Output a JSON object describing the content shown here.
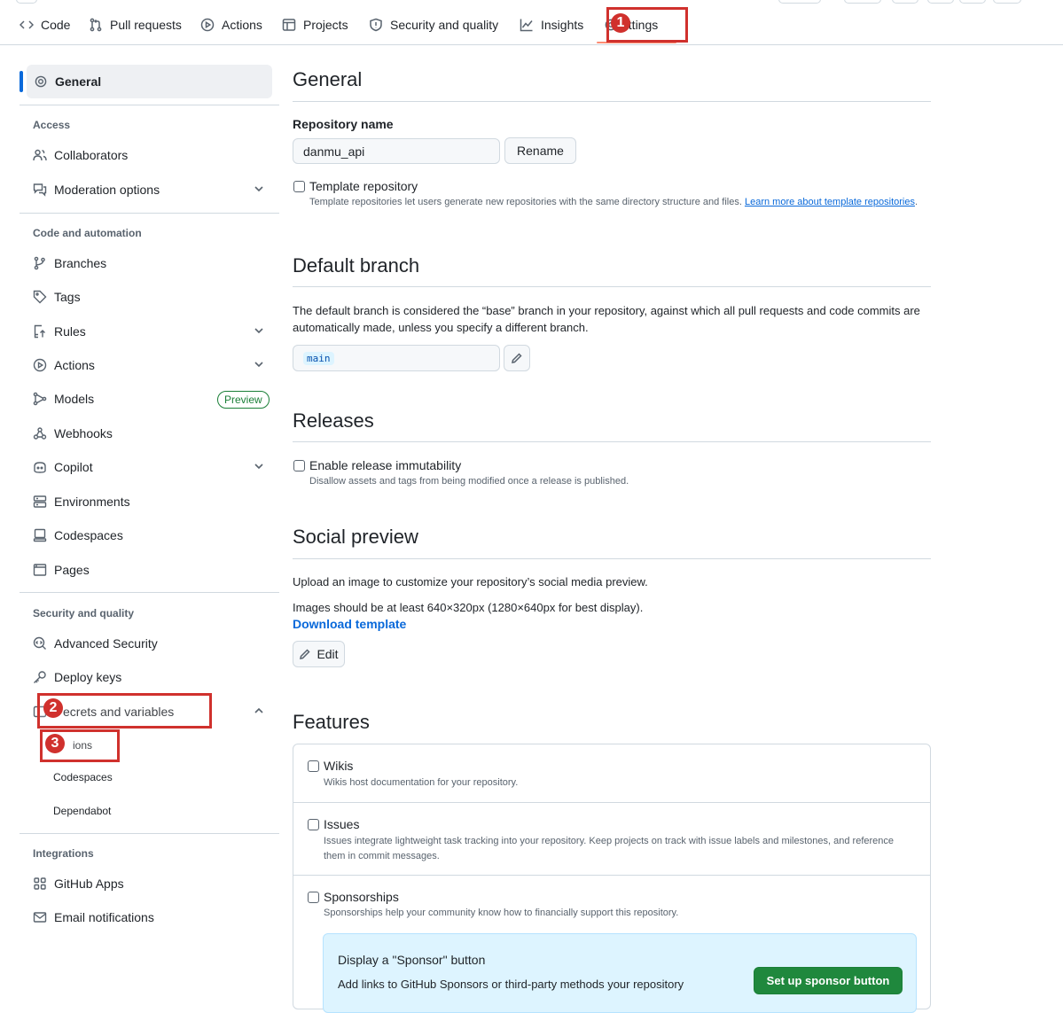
{
  "repo_nav": {
    "tabs": [
      {
        "label": "Code",
        "icon": "code-icon"
      },
      {
        "label": "Pull requests",
        "icon": "git-pull-request-icon"
      },
      {
        "label": "Actions",
        "icon": "play-icon"
      },
      {
        "label": "Projects",
        "icon": "table-icon"
      },
      {
        "label": "Security and quality",
        "icon": "shield-icon"
      },
      {
        "label": "Insights",
        "icon": "graph-icon"
      },
      {
        "label": "Settings",
        "icon": "gear-icon",
        "selected": true
      }
    ],
    "settings_visible": "ettings"
  },
  "annotations": [
    "1",
    "2",
    "3"
  ],
  "sidebar": {
    "general": "General",
    "groups": {
      "access": "Access",
      "code_automation": "Code and automation",
      "security": "Security and quality",
      "integrations": "Integrations"
    },
    "items": {
      "collaborators": "Collaborators",
      "moderation": "Moderation options",
      "branches": "Branches",
      "tags": "Tags",
      "rules": "Rules",
      "actions": "Actions",
      "models": "Models",
      "models_badge": "Preview",
      "webhooks": "Webhooks",
      "copilot": "Copilot",
      "environments": "Environments",
      "codespaces": "Codespaces",
      "pages": "Pages",
      "advanced_security": "Advanced Security",
      "deploy_keys": "Deploy keys",
      "secrets_visible": "ecrets and variables",
      "github_apps": "GitHub Apps",
      "email_notifications": "Email notifications"
    },
    "secrets_sub": {
      "actions_visible": "ions",
      "codespaces": "Codespaces",
      "dependabot": "Dependabot"
    }
  },
  "main": {
    "general_title": "General",
    "repo_name_label": "Repository name",
    "repo_name_value": "danmu_api",
    "rename_button": "Rename",
    "template": {
      "label": "Template repository",
      "desc": "Template repositories let users generate new repositories with the same directory structure and files.",
      "link": "Learn more about template repositories"
    },
    "default_branch": {
      "title": "Default branch",
      "desc": "The default branch is considered the “base” branch in your repository, against which all pull requests and code commits are automatically made, unless you specify a different branch.",
      "branch": "main"
    },
    "releases": {
      "title": "Releases",
      "label": "Enable release immutability",
      "desc": "Disallow assets and tags from being modified once a release is published."
    },
    "social": {
      "title": "Social preview",
      "desc1": "Upload an image to customize your repository’s social media preview.",
      "desc2": "Images should be at least 640×320px (1280×640px for best display).",
      "download": "Download template",
      "edit": "Edit"
    },
    "features": {
      "title": "Features",
      "wikis": {
        "label": "Wikis",
        "desc": "Wikis host documentation for your repository."
      },
      "issues": {
        "label": "Issues",
        "desc": "Issues integrate lightweight task tracking into your repository. Keep projects on track with issue labels and milestones, and reference them in commit messages."
      },
      "sponsorships": {
        "label": "Sponsorships",
        "desc": "Sponsorships help your community know how to financially support this repository."
      },
      "sponsor_box": {
        "title": "Display a \"Sponsor\" button",
        "desc": "Add links to GitHub Sponsors or third-party methods your repository",
        "button": "Set up sponsor button"
      }
    }
  }
}
